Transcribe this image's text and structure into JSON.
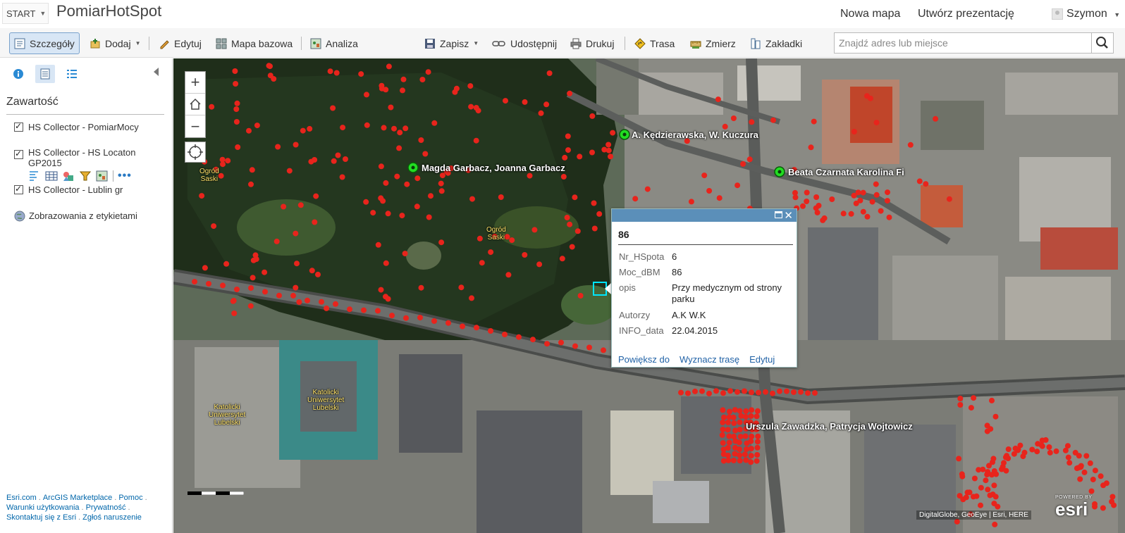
{
  "header": {
    "start_label": "START",
    "app_title": "PomiarHotSpot",
    "links": [
      "Nowa mapa",
      "Utwórz prezentację"
    ],
    "user_name": "Szymon"
  },
  "toolbar": {
    "details": "Szczegóły",
    "add": "Dodaj",
    "edit": "Edytuj",
    "basemap": "Mapa bazowa",
    "analysis": "Analiza",
    "save": "Zapisz",
    "share": "Udostępnij",
    "print": "Drukuj",
    "route": "Trasa",
    "measure": "Zmierz",
    "bookmarks": "Zakładki",
    "search_placeholder": "Znajdź adres lub miejsce"
  },
  "sidebar": {
    "heading": "Zawartość",
    "layers": [
      {
        "label": "HS Collector - PomiarMocy",
        "checked": true
      },
      {
        "label": "HS Collector - HS Locaton GP2015",
        "checked": true
      },
      {
        "label": "HS Collector - Lublin gr",
        "checked": true
      }
    ],
    "basemap_layer": "Zobrazowania z etykietami",
    "footer": {
      "links": [
        "Esri.com",
        "ArcGIS Marketplace",
        "Pomoc",
        "Warunki użytkowania",
        "Prywatność",
        "Skontaktuj się z Esri",
        "Zgłoś naruszenie"
      ]
    }
  },
  "map": {
    "point_labels": [
      "A. Kędzierawska, W. Kuczura",
      "Magda Garbacz, Joanna Garbacz",
      "Beata Czarnata Karolina Fi",
      "Urszula Zawadzka, Patrycja Wojtowicz"
    ],
    "poi_labels": [
      "Ogród\nSaski",
      "Ogród\nSaski",
      "Katolicki\nUniwersytet\nLubelski",
      "Katolicki\nUniwersytet\nLubelski"
    ],
    "attribution": "DigitalGlobe, GeoEye | Esri, HERE",
    "powered_by": "POWERED BY",
    "logo": "esri",
    "colors": {
      "point": "#e8241c",
      "highlight": "#22dd22",
      "popup_bar": "#5b8fb9"
    }
  },
  "popup": {
    "title": "86",
    "rows": [
      {
        "key": "Nr_HSpota",
        "value": "6"
      },
      {
        "key": "Moc_dBM",
        "value": "86"
      },
      {
        "key": "opis",
        "value": "Przy medycznym od strony parku"
      },
      {
        "key": "Autorzy",
        "value": "A.K W.K"
      },
      {
        "key": "INFO_data",
        "value": "22.04.2015"
      }
    ],
    "links": [
      "Powiększ do",
      "Wyznacz trasę",
      "Edytuj"
    ]
  }
}
